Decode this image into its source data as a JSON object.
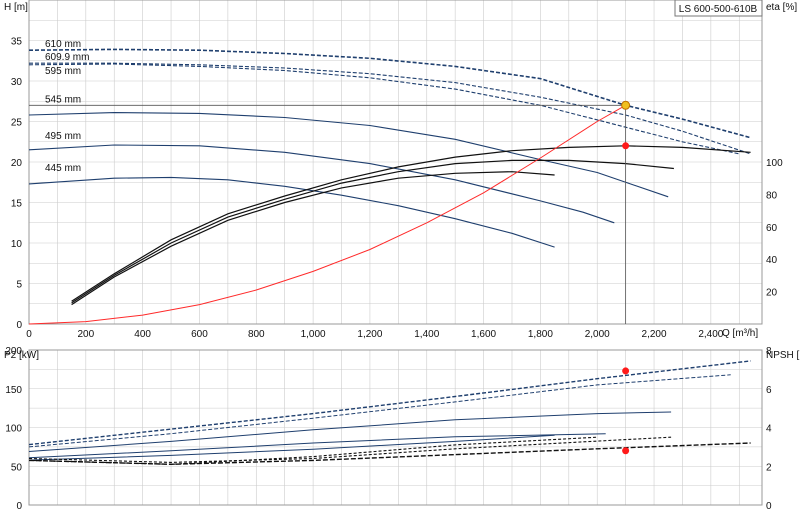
{
  "title": "LS 600-500-610B",
  "colors": {
    "curve": "#1f3f6e",
    "dark": "#111111",
    "system": "#ff2a2a",
    "grid": "#cccccc",
    "op_point": "#ff1a1a",
    "op_point_head": "#f0c020"
  },
  "chart_data": [
    {
      "type": "line",
      "title": "LS 600-500-610B",
      "xlabel": "Q [m³/h]",
      "ylabel": "H [m]",
      "y2label": "eta [%]",
      "xlim": [
        0,
        2580
      ],
      "ylim": [
        0,
        40
      ],
      "y2lim": [
        0,
        200
      ],
      "xticks": [
        "0",
        "200",
        "400",
        "600",
        "800",
        "1,000",
        "1,200",
        "1,400",
        "1,600",
        "1,800",
        "2,000",
        "2,200",
        "2,400"
      ],
      "yticks": [
        "0",
        "5",
        "10",
        "15",
        "20",
        "25",
        "30",
        "35"
      ],
      "y2ticks": [
        "20",
        "40",
        "60",
        "80",
        "100"
      ],
      "grid": true,
      "head_curves": [
        {
          "name": "610 mm",
          "x": [
            0,
            300,
            600,
            900,
            1200,
            1500,
            1800,
            2100,
            2300,
            2540
          ],
          "y": [
            33.8,
            33.9,
            33.8,
            33.4,
            32.8,
            31.8,
            30.3,
            27.0,
            25.3,
            23.0
          ]
        },
        {
          "name": "609.9 mm",
          "x": [
            0,
            300,
            600,
            900,
            1200,
            1500,
            1800,
            2100,
            2300,
            2540
          ],
          "y": [
            32.2,
            32.2,
            32.0,
            31.6,
            30.9,
            29.8,
            28.0,
            25.8,
            23.8,
            21.0
          ]
        },
        {
          "name": "595 mm",
          "x": [
            0,
            300,
            600,
            900,
            1200,
            1500,
            1800,
            2100,
            2300,
            2500
          ],
          "y": [
            32.0,
            32.1,
            31.8,
            31.3,
            30.4,
            29.0,
            27.0,
            24.3,
            22.5,
            21.0
          ]
        },
        {
          "name": "545 mm",
          "x": [
            0,
            300,
            600,
            900,
            1200,
            1500,
            1800,
            2000,
            2250
          ],
          "y": [
            25.8,
            26.1,
            26.0,
            25.5,
            24.5,
            22.8,
            20.3,
            18.7,
            15.7
          ]
        },
        {
          "name": "495 mm",
          "x": [
            0,
            300,
            600,
            900,
            1200,
            1500,
            1800,
            1950,
            2060
          ],
          "y": [
            21.5,
            22.1,
            22.0,
            21.2,
            19.8,
            17.8,
            15.2,
            13.8,
            12.5
          ]
        },
        {
          "name": "445 mm",
          "x": [
            0,
            300,
            500,
            700,
            900,
            1100,
            1300,
            1500,
            1700,
            1850
          ],
          "y": [
            17.3,
            18.0,
            18.1,
            17.8,
            17.0,
            15.9,
            14.6,
            13.0,
            11.2,
            9.5
          ]
        }
      ],
      "efficiency_curves": [
        {
          "x": [
            150,
            300,
            500,
            700,
            900,
            1100,
            1300,
            1500,
            1700,
            1900,
            2100,
            2300,
            2540
          ],
          "y": [
            14,
            31,
            52,
            68,
            79,
            89,
            97,
            103,
            107,
            109,
            110,
            109,
            106
          ]
        },
        {
          "x": [
            150,
            300,
            500,
            700,
            900,
            1100,
            1300,
            1500,
            1700,
            1900,
            2100,
            2270
          ],
          "y": [
            13,
            30,
            50,
            66,
            77,
            87,
            94,
            99,
            101,
            101,
            99,
            96
          ]
        },
        {
          "x": [
            150,
            300,
            500,
            700,
            900,
            1100,
            1300,
            1500,
            1700,
            1850
          ],
          "y": [
            12,
            29,
            48,
            64,
            75,
            84,
            90,
            93,
            94,
            92
          ]
        }
      ],
      "system_curve": {
        "x": [
          0,
          200,
          400,
          600,
          800,
          1000,
          1200,
          1400,
          1600,
          1800,
          2000,
          2100
        ],
        "y": [
          0,
          0.3,
          1.1,
          2.4,
          4.2,
          6.5,
          9.2,
          12.5,
          16.2,
          20.5,
          25.0,
          27.0
        ]
      },
      "operating_point": {
        "q": 2100,
        "head": 27.0,
        "eta": 110
      },
      "head_markers": [
        {
          "name": "610 mm",
          "h": 33.8
        },
        {
          "name": "609.9 mm",
          "h": 32.2
        },
        {
          "name": "595 mm",
          "h": 30.5
        },
        {
          "name": "545 mm",
          "h": 27.0
        },
        {
          "name": "495 mm",
          "h": 22.5
        },
        {
          "name": "445 mm",
          "h": 18.5
        }
      ]
    },
    {
      "type": "line",
      "ylabel": "P2 [kW]",
      "y2label": "NPSH [m]",
      "xlim": [
        0,
        2580
      ],
      "ylim": [
        0,
        200
      ],
      "y2lim": [
        0,
        8
      ],
      "yticks": [
        "0",
        "50",
        "100",
        "150",
        "200"
      ],
      "y2ticks": [
        "0",
        "2",
        "4",
        "6",
        "8"
      ],
      "grid": true,
      "power_curves": [
        {
          "x": [
            0,
            500,
            1000,
            1500,
            2000,
            2540
          ],
          "y": [
            78,
            98,
            118,
            140,
            163,
            186
          ]
        },
        {
          "x": [
            0,
            500,
            1000,
            1500,
            2000,
            2470
          ],
          "y": [
            75,
            92,
            112,
            133,
            155,
            168
          ]
        },
        {
          "x": [
            0,
            500,
            1000,
            1500,
            2000,
            2260
          ],
          "y": [
            69,
            82,
            97,
            110,
            118,
            120
          ]
        },
        {
          "x": [
            0,
            500,
            1000,
            1500,
            2030
          ],
          "y": [
            61,
            70,
            80,
            88,
            92
          ]
        },
        {
          "x": [
            0,
            500,
            1000,
            1500,
            1850
          ],
          "y": [
            58,
            64,
            72,
            82,
            90
          ]
        }
      ],
      "npsh_curves": [
        {
          "x": [
            0,
            500,
            1000,
            1500,
            2000,
            2540
          ],
          "y": [
            2.3,
            2.1,
            2.3,
            2.6,
            2.9,
            3.2
          ]
        },
        {
          "x": [
            0,
            500,
            1000,
            1500,
            2000,
            2260
          ],
          "y": [
            2.4,
            2.2,
            2.4,
            2.9,
            3.3,
            3.5
          ]
        },
        {
          "x": [
            0,
            500,
            1000,
            1500,
            2000
          ],
          "y": [
            2.3,
            2.1,
            2.5,
            3.1,
            3.5
          ]
        }
      ],
      "operating_point": {
        "q": 2100,
        "p2": 173,
        "npsh": 2.8
      }
    }
  ]
}
